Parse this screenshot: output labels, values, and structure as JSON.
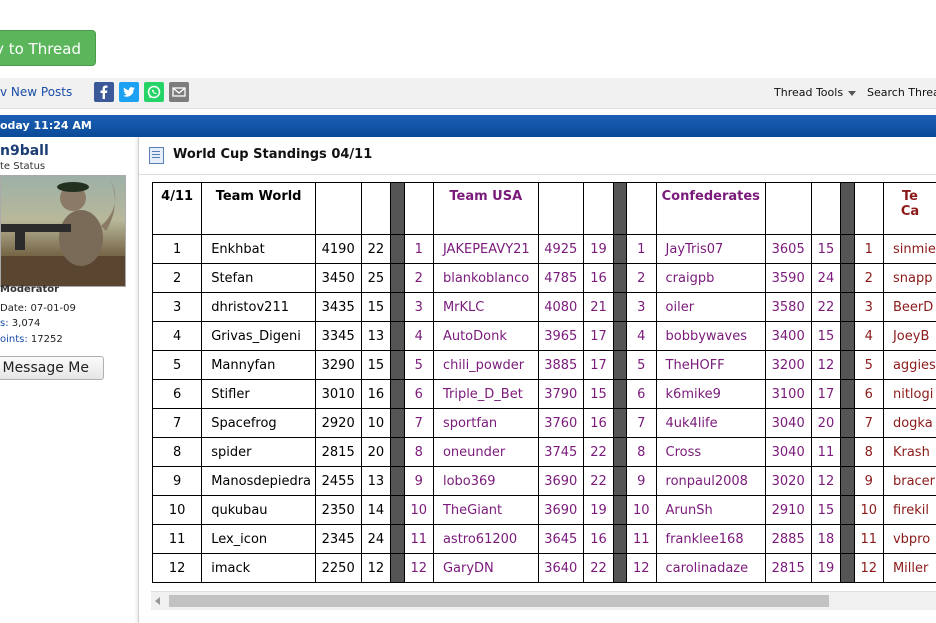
{
  "reply_button": "ply to Thread",
  "toolbar": {
    "new_posts": "v New Posts",
    "thread_tools": "Thread Tools",
    "search_thread": "Search Threa"
  },
  "bar": {
    "time": "oday 11:24 AM"
  },
  "user": {
    "name": "n9ball",
    "status": "te Status",
    "role": "Moderator",
    "join_label": "Date:",
    "join_value": "07-01-09",
    "posts_label": "s:",
    "posts_value": "3,074",
    "points_label": "oints:",
    "points_value": "17252",
    "message_button": "Message Me"
  },
  "post": {
    "title": "World Cup Standings 04/11"
  },
  "table": {
    "headers": {
      "date": "4/11",
      "world": "Team World",
      "usa": "Team USA",
      "conf": "Confederates",
      "fourth_line1": "Te",
      "fourth_line2": "Ca"
    },
    "rows": [
      {
        "r": "1",
        "w": "Enkhbat",
        "ws": "4190",
        "wn": "22",
        "u": "JAKEPEAVY21",
        "us": "4925",
        "un": "19",
        "c": "JayTris07",
        "cs": "3605",
        "cn": "15",
        "m": "sinmie"
      },
      {
        "r": "2",
        "w": "Stefan",
        "ws": "3450",
        "wn": "25",
        "u": "blankoblanco",
        "us": "4785",
        "un": "16",
        "c": "craigpb",
        "cs": "3590",
        "cn": "24",
        "m": "snapp"
      },
      {
        "r": "3",
        "w": "dhristov211",
        "ws": "3435",
        "wn": "15",
        "u": "MrKLC",
        "us": "4080",
        "un": "21",
        "c": "oiler",
        "cs": "3580",
        "cn": "22",
        "m": "BeerD"
      },
      {
        "r": "4",
        "w": "Grivas_Digeni",
        "ws": "3345",
        "wn": "13",
        "u": "AutoDonk",
        "us": "3965",
        "un": "17",
        "c": "bobbywaves",
        "cs": "3400",
        "cn": "15",
        "m": "JoeyB"
      },
      {
        "r": "5",
        "w": "Mannyfan",
        "ws": "3290",
        "wn": "15",
        "u": "chili_powder",
        "us": "3885",
        "un": "17",
        "c": "TheHOFF",
        "cs": "3200",
        "cn": "12",
        "m": "aggies"
      },
      {
        "r": "6",
        "w": "Stifler",
        "ws": "3010",
        "wn": "16",
        "u": "Triple_D_Bet",
        "us": "3790",
        "un": "15",
        "c": "k6mike9",
        "cs": "3100",
        "cn": "17",
        "m": "nitlogi"
      },
      {
        "r": "7",
        "w": "Spacefrog",
        "ws": "2920",
        "wn": "10",
        "u": "sportfan",
        "us": "3760",
        "un": "16",
        "c": "4uk4life",
        "cs": "3040",
        "cn": "20",
        "m": "dogka"
      },
      {
        "r": "8",
        "w": "spider",
        "ws": "2815",
        "wn": "20",
        "u": "oneunder",
        "us": "3745",
        "un": "22",
        "c": "Cross",
        "cs": "3040",
        "cn": "11",
        "m": "Krash"
      },
      {
        "r": "9",
        "w": "Manosdepiedra",
        "ws": "2455",
        "wn": "13",
        "u": "lobo369",
        "us": "3690",
        "un": "22",
        "c": "ronpaul2008",
        "cs": "3020",
        "cn": "12",
        "m": "bracer"
      },
      {
        "r": "10",
        "w": "qukubau",
        "ws": "2350",
        "wn": "14",
        "u": "TheGiant",
        "us": "3690",
        "un": "19",
        "c": "ArunSh",
        "cs": "2910",
        "cn": "15",
        "m": "firekil"
      },
      {
        "r": "11",
        "w": "Lex_icon",
        "ws": "2345",
        "wn": "24",
        "u": "astro61200",
        "us": "3645",
        "un": "16",
        "c": "franklee168",
        "cs": "2885",
        "cn": "18",
        "m": "vbpro"
      },
      {
        "r": "12",
        "w": "imack",
        "ws": "2250",
        "wn": "12",
        "u": "GaryDN",
        "us": "3640",
        "un": "22",
        "c": "carolinadaze",
        "cs": "2815",
        "cn": "19",
        "m": "Miller"
      }
    ]
  },
  "colors": {
    "accent_blue": "#0b4a98",
    "reply_green": "#5bb55b",
    "team_purple": "#7a1a7a",
    "team_maroon": "#8b1a1a"
  }
}
